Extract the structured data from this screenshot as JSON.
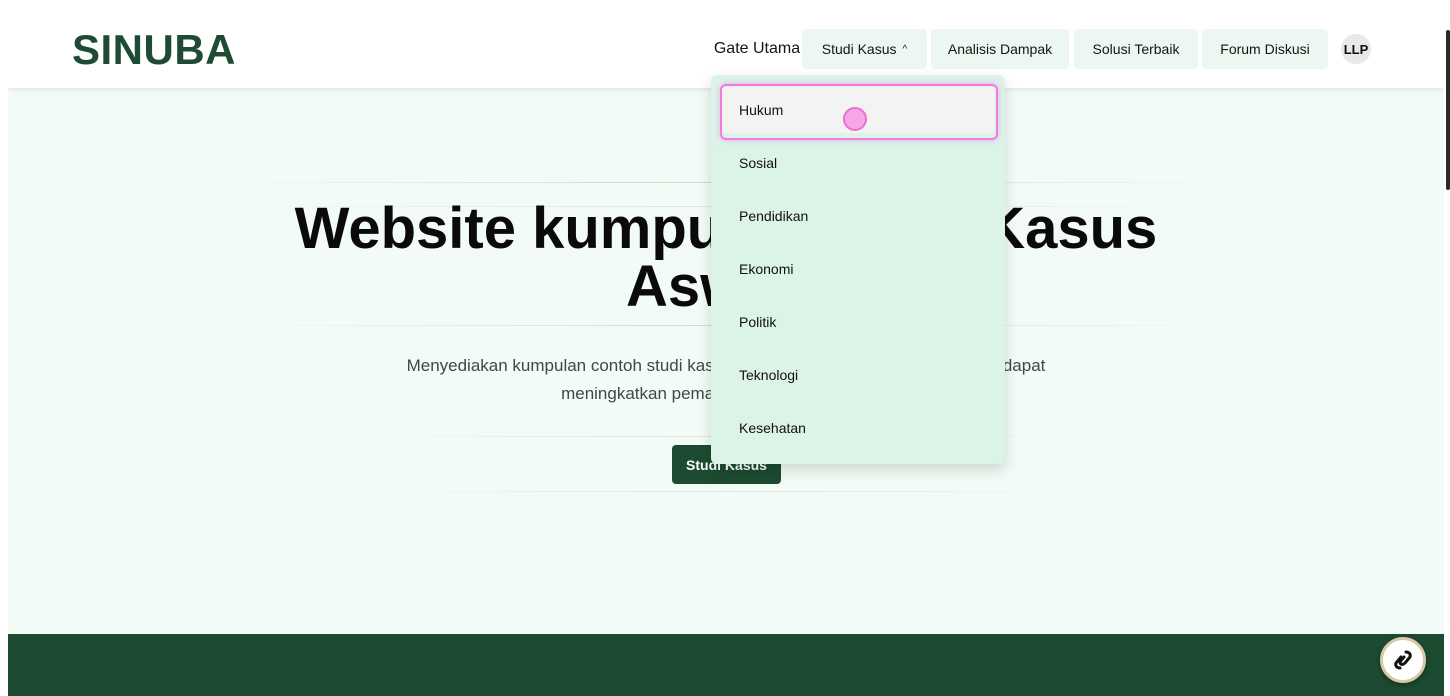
{
  "brand": {
    "name": "SINUBA",
    "color": "#1f4b35"
  },
  "nav": {
    "items": [
      {
        "label": "Gate Utama"
      },
      {
        "label": "Studi Kasus",
        "chevron": "^"
      },
      {
        "label": "Analisis Dampak"
      },
      {
        "label": "Solusi Terbaik"
      },
      {
        "label": "Forum Diskusi"
      }
    ],
    "avatar": "LLP"
  },
  "dropdown": {
    "items": [
      {
        "label": "Hukum"
      },
      {
        "label": "Sosial"
      },
      {
        "label": "Pendidikan"
      },
      {
        "label": "Ekonomi"
      },
      {
        "label": "Politik"
      },
      {
        "label": "Teknologi"
      },
      {
        "label": "Kesehatan"
      }
    ]
  },
  "hero": {
    "title": "Website kumpulan Studi Kasus Aswaja",
    "description": "Menyediakan kumpulan contoh studi kasus Aswaja. Kami harapkan website ini dapat meningkatkan pemahaman tentang Aswaja.",
    "cta": "Studi Kasus"
  },
  "colors": {
    "accent": "#1c4b31",
    "background": "#f2fbf6",
    "dropdown_bg": "#dcf3e8",
    "highlight": "#f27be0"
  },
  "icons": {
    "fab": "chat-bubble-icon"
  }
}
